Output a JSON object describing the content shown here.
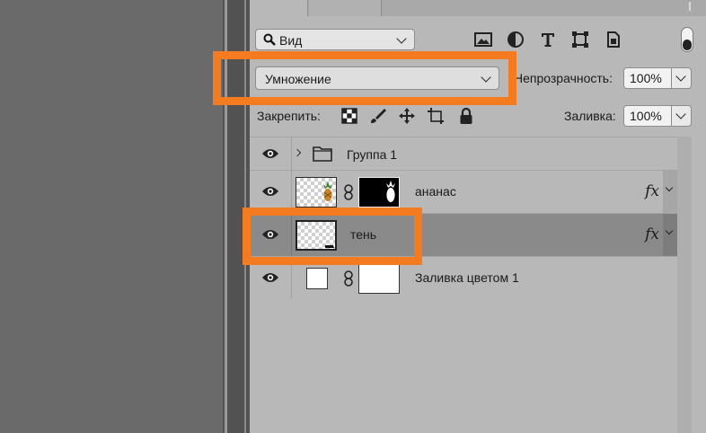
{
  "filter": {
    "kind_label": "Вид"
  },
  "blend": {
    "mode": "Умножение"
  },
  "opacity": {
    "label": "Непрозрачность:",
    "value": "100%"
  },
  "lock": {
    "label": "Закрепить:"
  },
  "fill": {
    "label": "Заливка:",
    "value": "100%"
  },
  "layers": [
    {
      "name": "Группа 1",
      "type": "group"
    },
    {
      "name": "ананас",
      "type": "layer",
      "fx": "fx"
    },
    {
      "name": "тень",
      "type": "layer",
      "fx": "fx",
      "selected": true
    },
    {
      "name": "Заливка цветом 1",
      "type": "fill"
    }
  ],
  "colors": {
    "highlight": "#f47b20",
    "panel_bg": "#b8b8b8",
    "selected_row": "#8a8a8a"
  }
}
